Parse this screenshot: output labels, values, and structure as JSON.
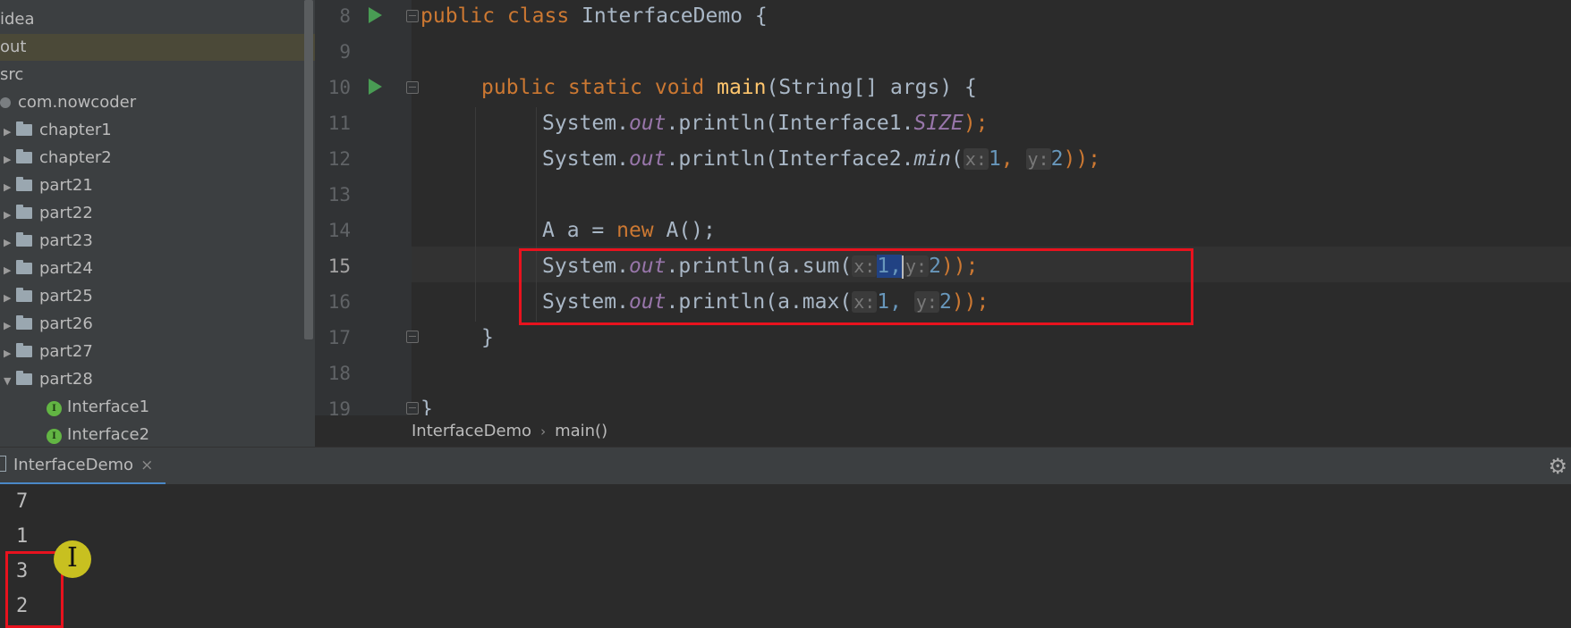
{
  "sidebar": {
    "items": [
      {
        "label": "idea",
        "kind": "dir"
      },
      {
        "label": "out",
        "kind": "dir",
        "selected": true
      },
      {
        "label": "src",
        "kind": "dir"
      },
      {
        "label": "com.nowcoder",
        "kind": "package"
      },
      {
        "label": "chapter1",
        "kind": "folder"
      },
      {
        "label": "chapter2",
        "kind": "folder"
      },
      {
        "label": "part21",
        "kind": "folder"
      },
      {
        "label": "part22",
        "kind": "folder"
      },
      {
        "label": "part23",
        "kind": "folder"
      },
      {
        "label": "part24",
        "kind": "folder"
      },
      {
        "label": "part25",
        "kind": "folder"
      },
      {
        "label": "part26",
        "kind": "folder"
      },
      {
        "label": "part27",
        "kind": "folder"
      },
      {
        "label": "part28",
        "kind": "folder",
        "expanded": true
      },
      {
        "label": "Interface1",
        "kind": "interface"
      },
      {
        "label": "Interface2",
        "kind": "interface"
      }
    ],
    "interface_icon_letter": "I"
  },
  "editor": {
    "line_numbers": [
      "8",
      "9",
      "10",
      "11",
      "12",
      "13",
      "14",
      "15",
      "16",
      "17",
      "18",
      "19"
    ],
    "current_line": "15",
    "lines": {
      "l8": {
        "kw": "public class",
        "rest": " InterfaceDemo {"
      },
      "l10": {
        "kw1": "public static void",
        "fn": "main",
        "rest": "(String[] args) {"
      },
      "l11": {
        "a": "System.",
        "b": "out",
        "c": ".println(Interface1.",
        "d": "SIZE",
        "e": ");"
      },
      "l12": {
        "a": "System.",
        "b": "out",
        "c": ".println(Interface2.",
        "d": "min",
        "e": "(",
        "h1": "x:",
        "v1": "1",
        "comma": ",",
        "h2": "y:",
        "v2": "2",
        "f": "));"
      },
      "l14": {
        "a": "A a = ",
        "kw": "new",
        "b": " A();"
      },
      "l15": {
        "a": "System.",
        "b": "out",
        "c": ".println(a.sum(",
        "h1": "x:",
        "v1": "1,",
        "h2": "y:",
        "v2": "2",
        "f": "));"
      },
      "l16": {
        "a": "System.",
        "b": "out",
        "c": ".println(a.max(",
        "h1": "x:",
        "v1": "1,",
        "h2": "y:",
        "v2": "2",
        "f": "));"
      },
      "l17": {
        "a": "}"
      },
      "l19": {
        "a": "}"
      }
    }
  },
  "breadcrumb": {
    "class_name": "InterfaceDemo",
    "separator": "›",
    "method": "main()"
  },
  "run_panel": {
    "tab_label": "InterfaceDemo",
    "close_glyph": "×",
    "settings_glyph": "⚙",
    "output": [
      "7",
      "1",
      "3",
      "2"
    ]
  },
  "colors": {
    "highlight_box": "#e8121e",
    "keyword": "#cc7832",
    "method": "#ffc66d",
    "static_field": "#9876aa",
    "number": "#6897bb",
    "run_icon": "#499c54",
    "cursor_highlight": "#c8c020"
  },
  "icons": [
    "run-icon",
    "fold-icon",
    "folder-icon",
    "package-icon",
    "interface-icon",
    "close-icon",
    "gear-icon",
    "cursor-ibeam-icon"
  ]
}
